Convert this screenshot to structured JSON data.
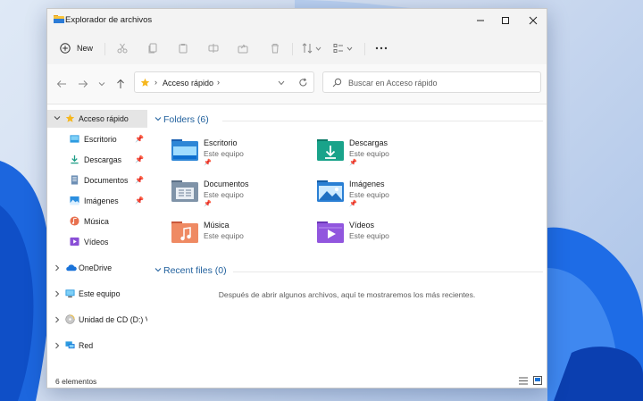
{
  "window": {
    "title": "Explorador de archivos"
  },
  "toolbar": {
    "new_label": "New"
  },
  "address": {
    "crumb": "Acceso rápido",
    "separator_left": "›",
    "separator_right": "›"
  },
  "search": {
    "placeholder": "Buscar en Acceso rápido"
  },
  "sidebar": {
    "items": [
      {
        "label": "Acceso rápido",
        "icon": "star-icon"
      },
      {
        "label": "Escritorio",
        "icon": "desktop-icon",
        "pinned": true
      },
      {
        "label": "Descargas",
        "icon": "download-icon",
        "pinned": true
      },
      {
        "label": "Documentos",
        "icon": "documents-icon",
        "pinned": true
      },
      {
        "label": "Imágenes",
        "icon": "pictures-icon",
        "pinned": true
      },
      {
        "label": "Música",
        "icon": "music-icon"
      },
      {
        "label": "Vídeos",
        "icon": "videos-icon"
      },
      {
        "label": "OneDrive",
        "icon": "cloud-icon"
      },
      {
        "label": "Este equipo",
        "icon": "computer-icon"
      },
      {
        "label": "Unidad de CD (D:) Vi",
        "icon": "cd-drive-icon"
      },
      {
        "label": "Red",
        "icon": "network-icon"
      }
    ]
  },
  "folders_section": {
    "heading": "Folders (6)",
    "items": [
      {
        "name": "Escritorio",
        "location": "Este equipo",
        "pinned": true,
        "icon": "desktop-folder-icon"
      },
      {
        "name": "Descargas",
        "location": "Este equipo",
        "pinned": true,
        "icon": "downloads-folder-icon"
      },
      {
        "name": "Documentos",
        "location": "Este equipo",
        "pinned": true,
        "icon": "documents-folder-icon"
      },
      {
        "name": "Imágenes",
        "location": "Este equipo",
        "pinned": true,
        "icon": "pictures-folder-icon"
      },
      {
        "name": "Música",
        "location": "Este equipo",
        "pinned": false,
        "icon": "music-folder-icon"
      },
      {
        "name": "Vídeos",
        "location": "Este equipo",
        "pinned": false,
        "icon": "videos-folder-icon"
      }
    ]
  },
  "recent_section": {
    "heading": "Recent files (0)",
    "empty_message": "Después de abrir algunos archivos, aquí te mostraremos los más recientes."
  },
  "status": {
    "count_text": "6 elementos"
  },
  "colors": {
    "accent": "#1f5f9c",
    "wallpaper_blue": "#1a5fd6"
  }
}
